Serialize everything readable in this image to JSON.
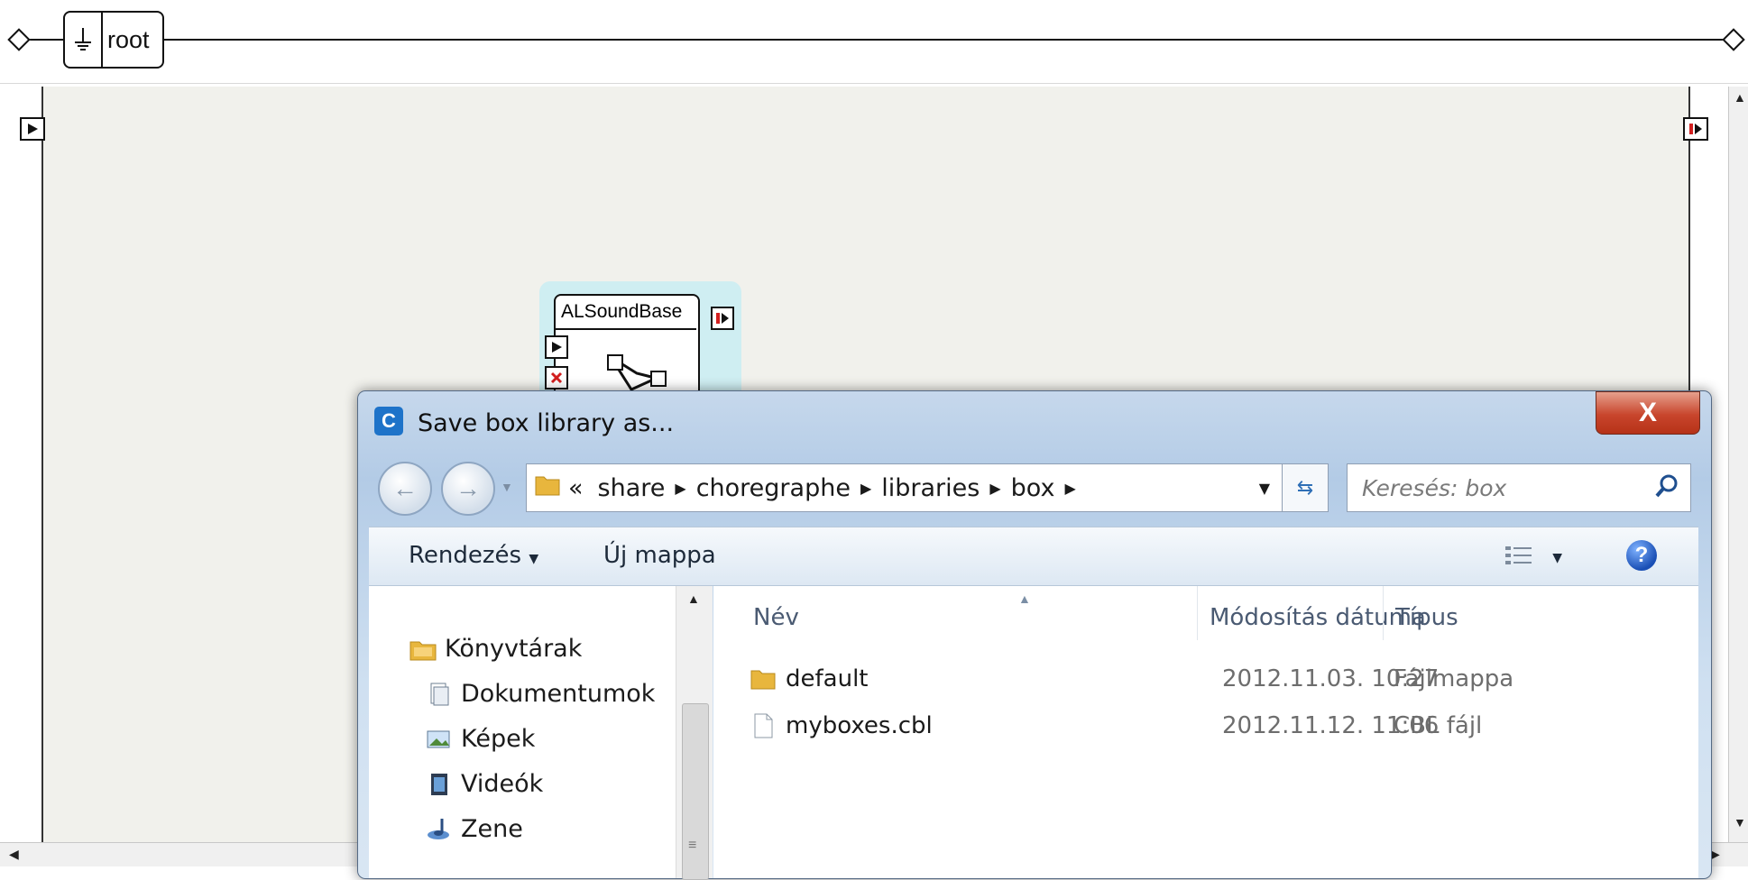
{
  "breadcrumb": {
    "root_label": "root"
  },
  "node": {
    "title": "ALSoundBase"
  },
  "dialog": {
    "title": "Save box library as...",
    "app_icon_letter": "C",
    "close_label": "X",
    "address": {
      "overflow": "«",
      "segments": [
        "share",
        "choregraphe",
        "libraries",
        "box"
      ]
    },
    "search_placeholder": "Keresés: box",
    "toolbar": {
      "organize_label": "Rendezés",
      "new_folder_label": "Új mappa",
      "help_label": "?"
    },
    "nav": {
      "items": [
        "Könyvtárak",
        "Dokumentumok",
        "Képek",
        "Videók",
        "Zene"
      ]
    },
    "columns": {
      "name": "Név",
      "modified": "Módosítás dátuma",
      "type": "Típus"
    },
    "files": [
      {
        "name": "default",
        "modified": "2012.11.03. 10:27",
        "type": "Fájlmappa",
        "icon": "folder-icon"
      },
      {
        "name": "myboxes.cbl",
        "modified": "2012.11.12. 11:06",
        "type": "CBL fájl",
        "icon": "file-icon"
      }
    ]
  },
  "colors": {
    "close": "#c8452c",
    "accent": "#1e73c9",
    "canvas": "#f1f1ec",
    "node_halo": "#cfeef2"
  }
}
